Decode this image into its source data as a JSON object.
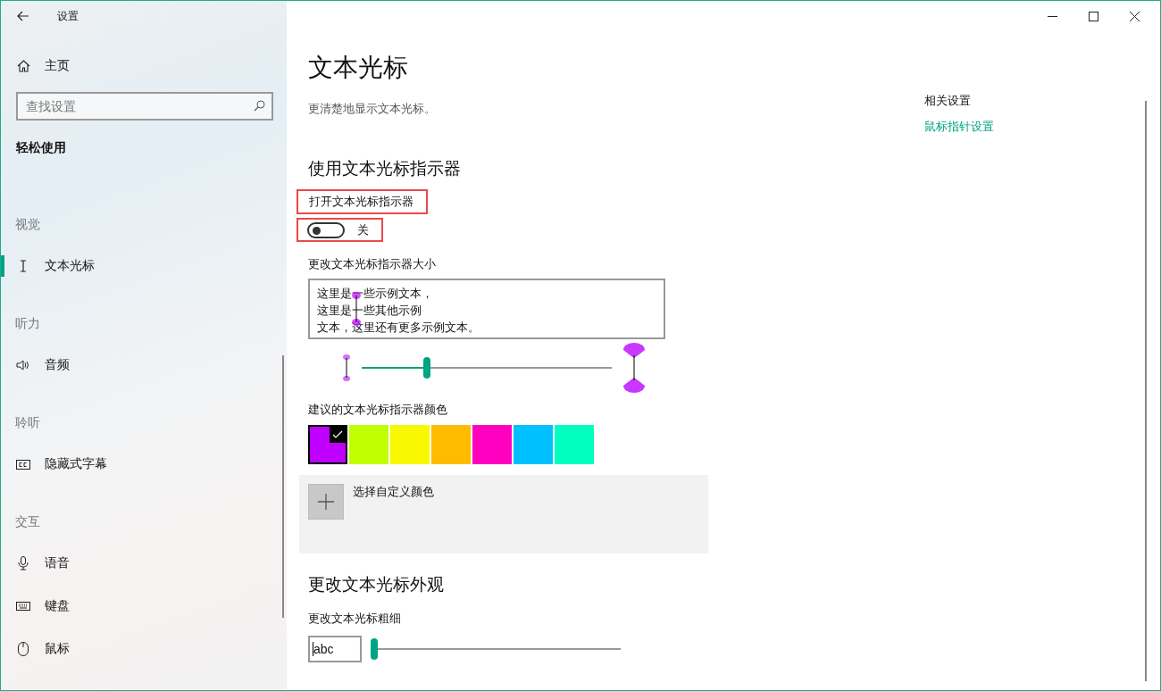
{
  "window": {
    "title": "设置"
  },
  "sidebar": {
    "home": "主页",
    "search": {
      "placeholder": "查找设置"
    },
    "section_title": "轻松使用",
    "groups": [
      {
        "heading": "视觉",
        "items": [
          {
            "label": "文本光标",
            "kind": "cursor",
            "selected": true
          }
        ]
      },
      {
        "heading": "听力",
        "items": [
          {
            "label": "音频",
            "kind": "audio",
            "selected": false
          }
        ]
      },
      {
        "heading": "聆听",
        "items": [
          {
            "label": "隐藏式字幕",
            "kind": "captions",
            "selected": false
          }
        ]
      },
      {
        "heading": "交互",
        "items": [
          {
            "label": "语音",
            "kind": "speech",
            "selected": false
          },
          {
            "label": "键盘",
            "kind": "keyboard",
            "selected": false
          },
          {
            "label": "鼠标",
            "kind": "mouse",
            "selected": false
          }
        ]
      }
    ]
  },
  "page": {
    "title": "文本光标",
    "subtitle": "更清楚地显示文本光标。",
    "related": {
      "heading": "相关设置",
      "link": "鼠标指针设置"
    },
    "indicator": {
      "heading": "使用文本光标指示器",
      "toggle": {
        "label": "打开文本光标指示器",
        "on": false,
        "state_text": "关",
        "highlighted": true
      },
      "size_label": "更改文本光标指示器大小",
      "preview_lines": [
        "这里是一些示例文本，",
        "这里是一些其他示例",
        "文本，这里还有更多示例文本。"
      ],
      "size_slider": {
        "level": 0.26
      },
      "colors_label": "建议的文本光标指示器颜色",
      "colors": [
        {
          "color": "#c000ff",
          "selected": true
        },
        {
          "color": "#c0ff00",
          "selected": false
        },
        {
          "color": "#f8f800",
          "selected": false
        },
        {
          "color": "#ffbb00",
          "selected": false
        },
        {
          "color": "#ff00c0",
          "selected": false
        },
        {
          "color": "#00c0ff",
          "selected": false
        },
        {
          "color": "#00ffc0",
          "selected": false
        }
      ],
      "custom_color": "选择自定义颜色"
    },
    "appearance": {
      "heading": "更改文本光标外观",
      "thickness_label": "更改文本光标粗细",
      "preview": "abc",
      "thickness_slider": {
        "level": 0
      }
    }
  }
}
